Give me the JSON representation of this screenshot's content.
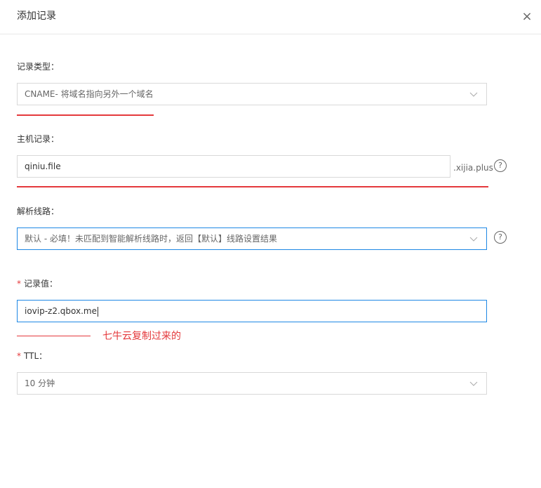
{
  "dialog": {
    "title": "添加记录",
    "close_icon": "×"
  },
  "fields": {
    "record_type": {
      "label": "记录类型：",
      "value": "CNAME- 将域名指向另外一个域名"
    },
    "host": {
      "label": "主机记录：",
      "value": "qiniu.file",
      "suffix": ".xijia.plus"
    },
    "line": {
      "label": "解析线路：",
      "value": "默认 - 必填！未匹配到智能解析线路时，返回【默认】线路设置结果"
    },
    "record_value": {
      "required_mark": "*",
      "label": "记录值：",
      "value": "iovip-z2.qbox.me"
    },
    "ttl": {
      "required_mark": "*",
      "label": "TTL：",
      "value": "10 分钟"
    }
  },
  "annotation": {
    "text": "七牛云复制过来的"
  },
  "colors": {
    "annotation_red": "#e4393c",
    "focus_blue": "#1e88e5",
    "border_gray": "#d9d9d9"
  },
  "icons": {
    "help": "?",
    "dropdown": "chevron-down"
  }
}
